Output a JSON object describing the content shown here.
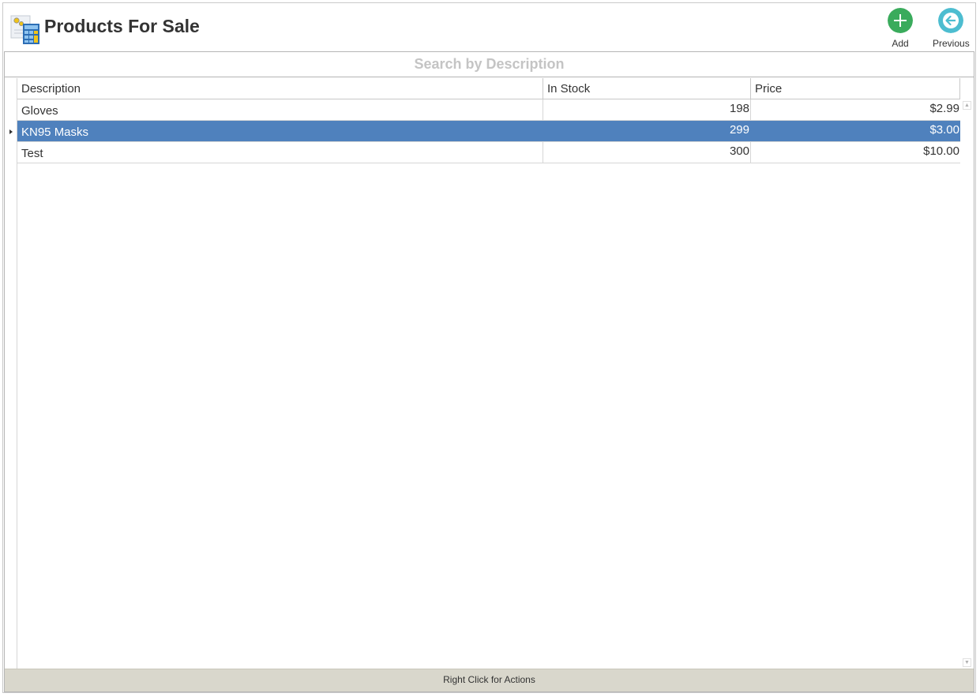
{
  "header": {
    "title": "Products For Sale",
    "app_icon": "calculator-document-icon"
  },
  "toolbar": {
    "add": {
      "label": "Add",
      "icon": "plus-circle-icon",
      "color": "#3aab5c"
    },
    "previous": {
      "label": "Previous",
      "icon": "arrow-left-circle-icon",
      "color": "#4dbdd0"
    }
  },
  "search": {
    "placeholder": "Search by Description",
    "value": ""
  },
  "table": {
    "columns": [
      "Description",
      "In Stock",
      "Price"
    ],
    "rows": [
      {
        "description": "Gloves",
        "in_stock": "198",
        "price": "$2.99",
        "selected": false
      },
      {
        "description": "KN95 Masks",
        "in_stock": "299",
        "price": "$3.00",
        "selected": true
      },
      {
        "description": "Test",
        "in_stock": "300",
        "price": "$10.00",
        "selected": false
      }
    ],
    "selection_color": "#4f81bd"
  },
  "status_bar": {
    "text": "Right Click for Actions"
  }
}
